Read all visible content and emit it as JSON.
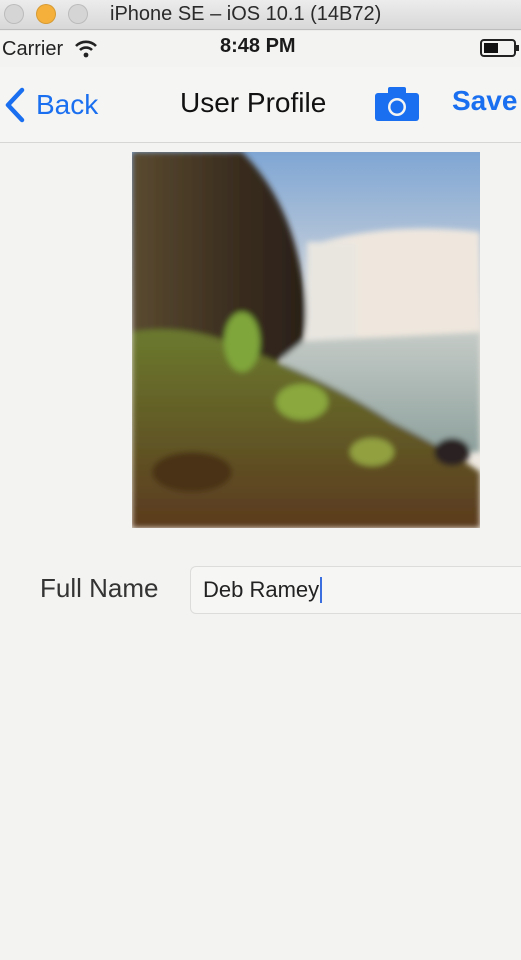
{
  "window": {
    "title": "iPhone SE – iOS 10.1 (14B72)"
  },
  "status_bar": {
    "carrier": "Carrier",
    "time": "8:48 PM"
  },
  "nav": {
    "back_label": "Back",
    "title": "User Profile",
    "save_label": "Save"
  },
  "colors": {
    "accent": "#1a6ff0"
  },
  "form": {
    "full_name_label": "Full Name",
    "full_name_value": "Deb Ramey"
  },
  "icons": [
    "wifi-icon",
    "battery-icon",
    "chevron-left-icon",
    "camera-icon"
  ]
}
